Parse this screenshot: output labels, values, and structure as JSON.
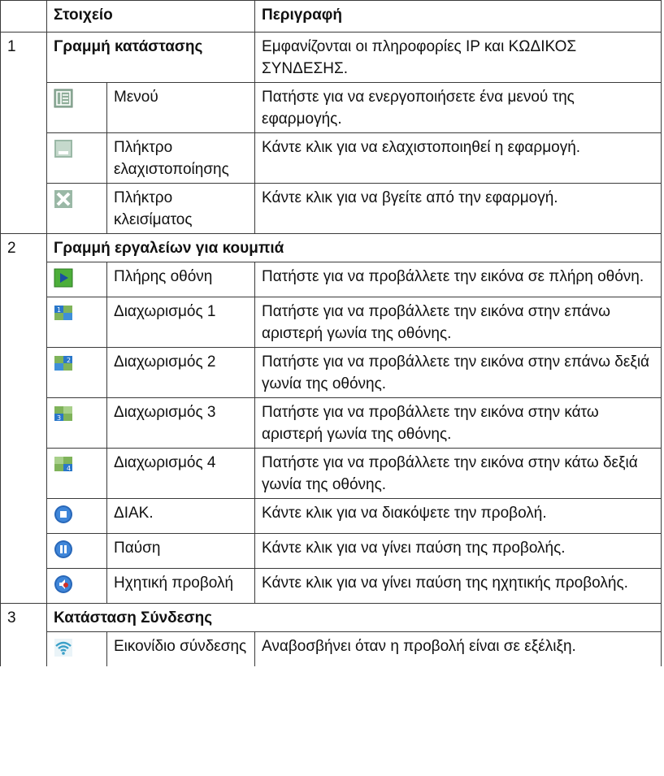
{
  "header": {
    "item": "Στοιχείο",
    "description": "Περιγραφή"
  },
  "sections": [
    {
      "number": "1",
      "title": "Γραμμή κατάστασης",
      "title_description": "Εμφανίζονται οι πληροφορίες IP και ΚΩΔΙΚΟΣ ΣΥΝΔΕΣΗΣ.",
      "rows": [
        {
          "icon": "menu-icon",
          "name": "Μενού",
          "description": "Πατήστε για να ενεργοποιήσετε ένα μενού της εφαρμογής."
        },
        {
          "icon": "minimize-icon",
          "name": "Πλήκτρο ελαχιστοποίησης",
          "description": "Κάντε κλικ για να ελαχιστοποιηθεί η εφαρμογή."
        },
        {
          "icon": "close-icon",
          "name": "Πλήκτρο κλεισίματος",
          "description": "Κάντε κλικ για να βγείτε από την εφαρμογή."
        }
      ]
    },
    {
      "number": "2",
      "title": "Γραμμή εργαλείων για κουμπιά",
      "rows": [
        {
          "icon": "play-fullscreen-icon",
          "name": "Πλήρης οθόνη",
          "description": "Πατήστε για να προβάλλετε την εικόνα σε πλήρη οθόνη."
        },
        {
          "icon": "split-1-icon",
          "name": "Διαχωρισμός 1",
          "description": "Πατήστε για να προβάλλετε την εικόνα στην επάνω αριστερή γωνία της οθόνης."
        },
        {
          "icon": "split-2-icon",
          "name": "Διαχωρισμός 2",
          "description": "Πατήστε για να προβάλλετε την εικόνα στην επάνω δεξιά γωνία της οθόνης."
        },
        {
          "icon": "split-3-icon",
          "name": "Διαχωρισμός 3",
          "description": "Πατήστε για να προβάλλετε την εικόνα στην κάτω αριστερή γωνία της οθόνης."
        },
        {
          "icon": "split-4-icon",
          "name": "Διαχωρισμός 4",
          "description": "Πατήστε για να προβάλλετε την εικόνα στην κάτω δεξιά γωνία της οθόνης."
        },
        {
          "icon": "stop-icon",
          "name": "ΔΙΑΚ.",
          "description": "Κάντε κλικ για να διακόψετε την προβολή."
        },
        {
          "icon": "pause-icon",
          "name": "Παύση",
          "description": "Κάντε κλικ για να γίνει παύση της προβολής."
        },
        {
          "icon": "audio-projection-icon",
          "name": "Ηχητική προβολή",
          "description": "Κάντε κλικ για να γίνει παύση της ηχητικής προβολής."
        }
      ]
    },
    {
      "number": "3",
      "title": "Κατάσταση Σύνδεσης",
      "rows": [
        {
          "icon": "wifi-connection-icon",
          "name": "Εικονίδιο σύνδεσης",
          "description": "Αναβοσβήνει όταν η προβολή είναι σε εξέλιξη."
        }
      ]
    }
  ]
}
